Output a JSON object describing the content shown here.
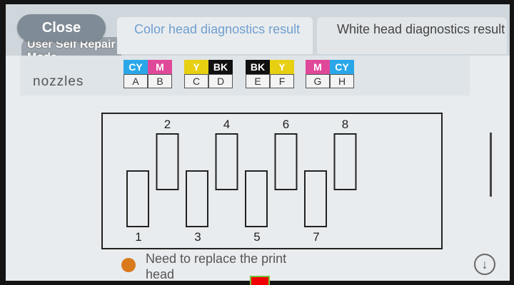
{
  "header": {
    "close_label": "Close",
    "under_label": "User Self Repair Mode",
    "tabs": [
      {
        "label": "Color head diagnostics result",
        "active": true
      },
      {
        "label": "White head diagnostics result",
        "active": false
      }
    ]
  },
  "nozzles": {
    "label": "nozzles",
    "pairs": [
      {
        "colors": [
          "CY",
          "M"
        ],
        "letters": [
          "A",
          "B"
        ]
      },
      {
        "colors": [
          "Y",
          "BK"
        ],
        "letters": [
          "C",
          "D"
        ]
      },
      {
        "colors": [
          "BK",
          "Y"
        ],
        "letters": [
          "E",
          "F"
        ]
      },
      {
        "colors": [
          "M",
          "CY"
        ],
        "letters": [
          "G",
          "H"
        ]
      }
    ]
  },
  "ink_colors": {
    "CY": "#2aa7e8",
    "M": "#e0489a",
    "Y": "#e7cf12",
    "BK": "#111111"
  },
  "diagram": {
    "labels": [
      "1",
      "2",
      "3",
      "4",
      "5",
      "6",
      "7",
      "8"
    ]
  },
  "status": {
    "text": "Need to replace the print head",
    "color": "#d97a1c"
  },
  "controls": {
    "scroll_down_icon": "arrow-down-icon"
  }
}
